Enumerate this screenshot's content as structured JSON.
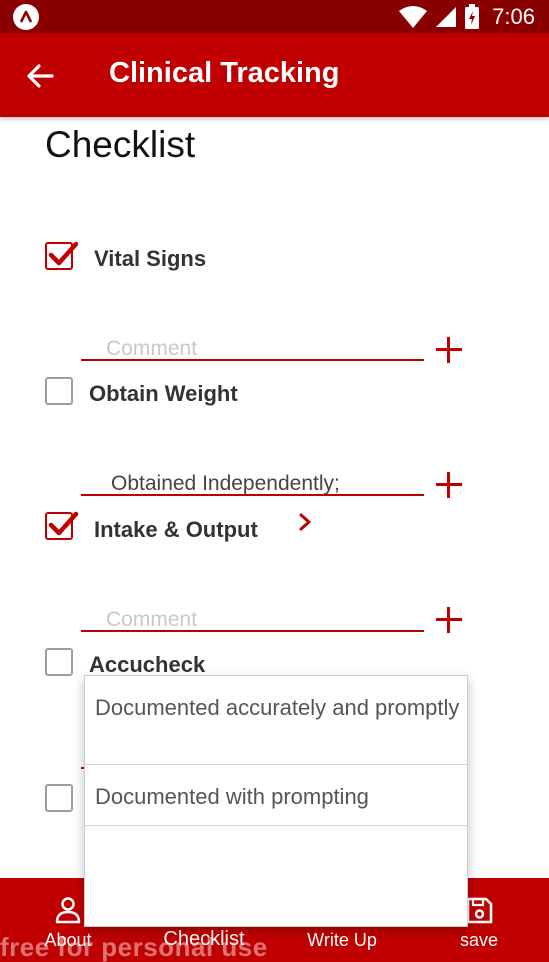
{
  "status_bar": {
    "time": "7:06",
    "icons": [
      "app-logo-icon",
      "wifi-icon",
      "signal-icon",
      "battery-charging-icon"
    ]
  },
  "app_bar": {
    "title": "Clinical Tracking",
    "back_icon": "arrow-left-icon"
  },
  "page_title": "Checklist",
  "checklist": {
    "items": [
      {
        "label": "Vital Signs",
        "checked": true
      },
      {
        "label": "Obtain Weight",
        "checked": false
      },
      {
        "label": "Intake & Output",
        "checked": true
      },
      {
        "label": "Accucheck",
        "checked": false
      },
      {
        "label": "",
        "checked": false
      }
    ],
    "comments": [
      {
        "value": "",
        "placeholder": "Comment"
      },
      {
        "value": "Obtained Independently;",
        "placeholder": ""
      },
      {
        "value": "",
        "placeholder": "Comment"
      }
    ]
  },
  "dropdown": {
    "options": [
      "Documented accurately and promptly",
      "Documented with prompting",
      ""
    ]
  },
  "bottom_nav": {
    "items": [
      {
        "label": "About",
        "icon": "person-icon",
        "active": false
      },
      {
        "label": "Checklist",
        "icon": "checklist-icon",
        "active": true
      },
      {
        "label": "Write Up",
        "icon": "edit-icon",
        "active": false
      },
      {
        "label": "save",
        "icon": "save-icon",
        "active": false
      }
    ]
  },
  "watermark": "free for personal use",
  "colors": {
    "primary": "#c00000",
    "status_bar": "#8a0000",
    "placeholder": "#c8c8c8"
  }
}
